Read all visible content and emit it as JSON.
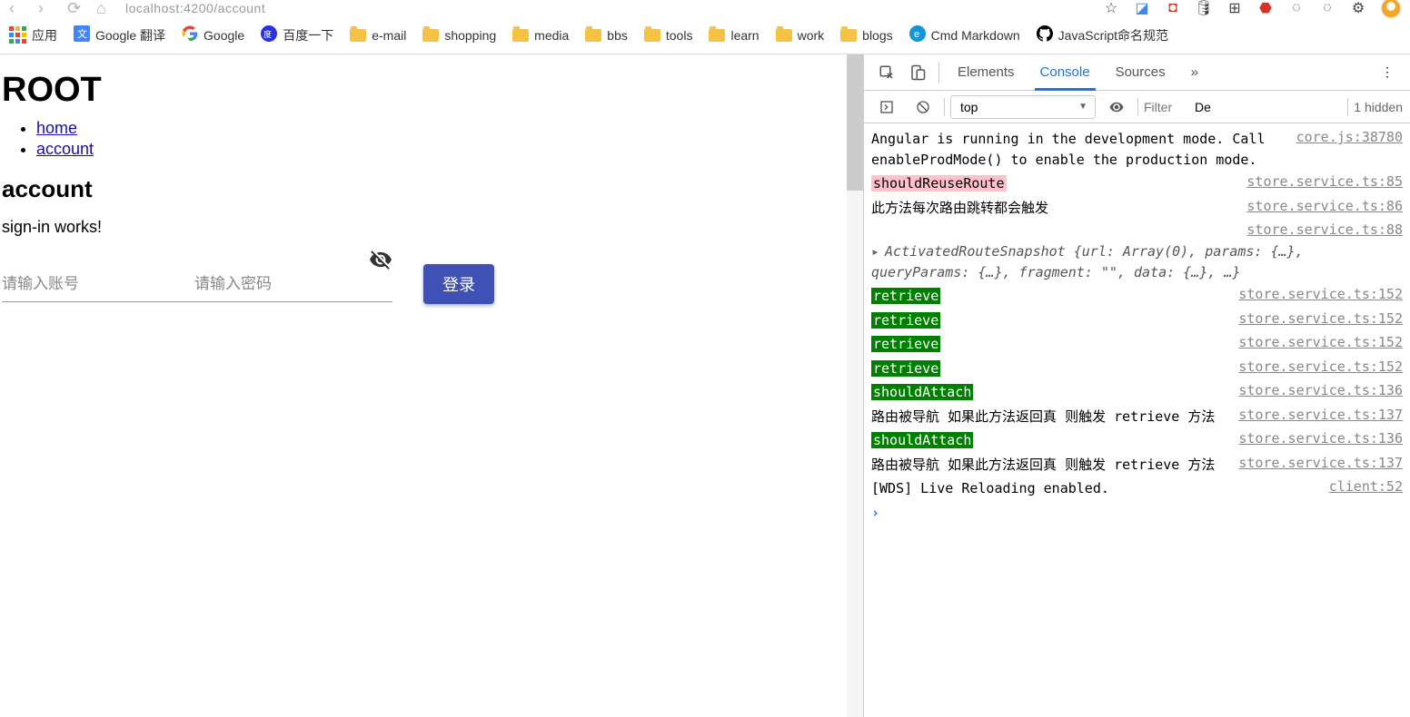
{
  "url": "localhost:4200/account",
  "bookmarks": [
    {
      "label": "应用",
      "icon": "apps"
    },
    {
      "label": "Google 翻译",
      "icon": "translate"
    },
    {
      "label": "Google",
      "icon": "google"
    },
    {
      "label": "百度一下",
      "icon": "baidu"
    },
    {
      "label": "e-mail",
      "icon": "folder"
    },
    {
      "label": "shopping",
      "icon": "folder"
    },
    {
      "label": "media",
      "icon": "folder"
    },
    {
      "label": "bbs",
      "icon": "folder"
    },
    {
      "label": "tools",
      "icon": "folder"
    },
    {
      "label": "learn",
      "icon": "folder"
    },
    {
      "label": "work",
      "icon": "folder"
    },
    {
      "label": "blogs",
      "icon": "folder"
    },
    {
      "label": "Cmd Markdown",
      "icon": "cmd"
    },
    {
      "label": "JavaScript命名规范",
      "icon": "github"
    }
  ],
  "page": {
    "h1": "ROOT",
    "nav": [
      {
        "text": "home",
        "href": "#"
      },
      {
        "text": "account",
        "href": "#"
      }
    ],
    "h2": "account",
    "signin": "sign-in works!",
    "username_ph": "请输入账号",
    "password_ph": "请输入密码",
    "login": "登录"
  },
  "devtools": {
    "tabs": [
      "Elements",
      "Console",
      "Sources"
    ],
    "active": "Console",
    "context": "top",
    "filter_ph": "Filter",
    "levels": "De",
    "hidden": "1 hidden",
    "log": [
      {
        "msg": "Angular is running in the development mode. Call enableProdMode() to enable the production mode.",
        "src": "core.js:38780"
      },
      {
        "msg": "shouldReuseRoute",
        "src": "store.service.ts:85",
        "hl": "pink"
      },
      {
        "msg": "此方法每次路由跳转都会触发",
        "src": "store.service.ts:86"
      },
      {
        "msg": "",
        "src": "store.service.ts:88"
      },
      {
        "msg": "ActivatedRouteSnapshot {url: Array(0), params: {…}, queryParams: {…}, fragment: \"\", data: {…}, …}",
        "obj": true,
        "expand": true
      },
      {
        "msg": "retrieve",
        "src": "store.service.ts:152",
        "hl": "green"
      },
      {
        "msg": "retrieve",
        "src": "store.service.ts:152",
        "hl": "green"
      },
      {
        "msg": "retrieve",
        "src": "store.service.ts:152",
        "hl": "green"
      },
      {
        "msg": "retrieve",
        "src": "store.service.ts:152",
        "hl": "green"
      },
      {
        "msg": "shouldAttach",
        "src": "store.service.ts:136",
        "hl": "green"
      },
      {
        "msg": "路由被导航 如果此方法返回真 则触发 retrieve 方法",
        "src": "store.service.ts:137"
      },
      {
        "msg": "shouldAttach",
        "src": "store.service.ts:136",
        "hl": "green"
      },
      {
        "msg": "路由被导航 如果此方法返回真 则触发 retrieve 方法",
        "src": "store.service.ts:137"
      },
      {
        "msg": "[WDS] Live Reloading enabled.",
        "src": "client:52"
      }
    ]
  }
}
